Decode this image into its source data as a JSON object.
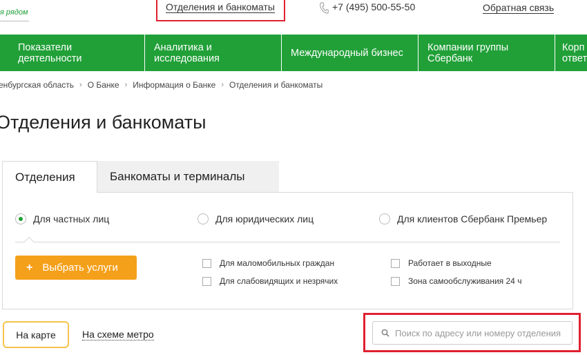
{
  "header": {
    "logo_tagline": "я рядом",
    "top_link": "Отделения и банкоматы",
    "phone": "+7 (495) 500-55-50",
    "feedback": "Обратная связь"
  },
  "nav": {
    "items": [
      {
        "label": "Показатели\nдеятельности"
      },
      {
        "label": "Аналитика и\nисследования"
      },
      {
        "label": "Международный бизнес"
      },
      {
        "label": "Компании группы\nСбербанк"
      },
      {
        "label": "Корп\nответ"
      }
    ]
  },
  "breadcrumb": {
    "items": [
      "енбургская область",
      "О Банке",
      "Информация о Банке",
      "Отделения и банкоматы"
    ],
    "separator": "›"
  },
  "page_title": "Отделения и банкоматы",
  "tabs": [
    {
      "label": "Отделения",
      "active": true
    },
    {
      "label": "Банкоматы и терминалы",
      "active": false
    }
  ],
  "filters": {
    "client_types": [
      {
        "label": "Для частных лиц",
        "checked": true
      },
      {
        "label": "Для юридических лиц",
        "checked": false
      },
      {
        "label": "Для клиентов Сбербанк Премьер",
        "checked": false
      }
    ],
    "select_services_button": "Выбрать услуги",
    "options": [
      {
        "label": "Для маломобильных граждан"
      },
      {
        "label": "Для слабовидящих и незрячих"
      },
      {
        "label": "Работает в выходные"
      },
      {
        "label": "Зона самообслуживания 24 ч"
      }
    ]
  },
  "view": {
    "map_button": "На карте",
    "metro_link": "На схеме метро"
  },
  "search": {
    "placeholder": "Поиск по адресу или номеру отделения"
  },
  "colors": {
    "brand_green": "#21a038",
    "accent_orange": "#f5a01a",
    "highlight_red": "#e02030"
  }
}
